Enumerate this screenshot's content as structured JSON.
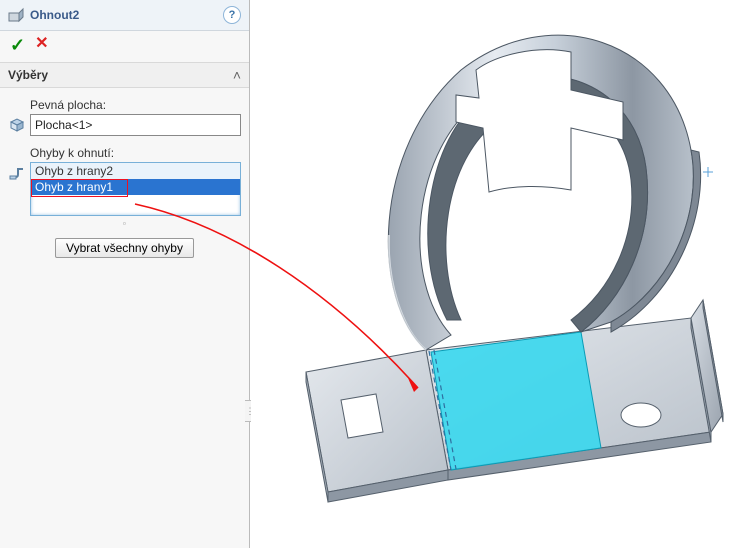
{
  "feature": {
    "title": "Ohnout2",
    "help": "?",
    "ok_glyph": "✓",
    "cancel_glyph": "✕"
  },
  "section": {
    "header": "Výběry",
    "collapse_glyph": "˄"
  },
  "fixed_face": {
    "label": "Pevná plocha:",
    "value": "Plocha<1>"
  },
  "bends": {
    "label": "Ohyby k ohnutí:",
    "items": [
      "Ohyb z hrany2",
      "Ohyb z hrany1"
    ],
    "selected_index": 1,
    "button": "Vybrat všechny ohyby",
    "pin_glyph": "◦"
  },
  "icons": {
    "feature": "fold-feature-icon",
    "face": "face-select-icon",
    "bend": "bend-select-icon"
  }
}
